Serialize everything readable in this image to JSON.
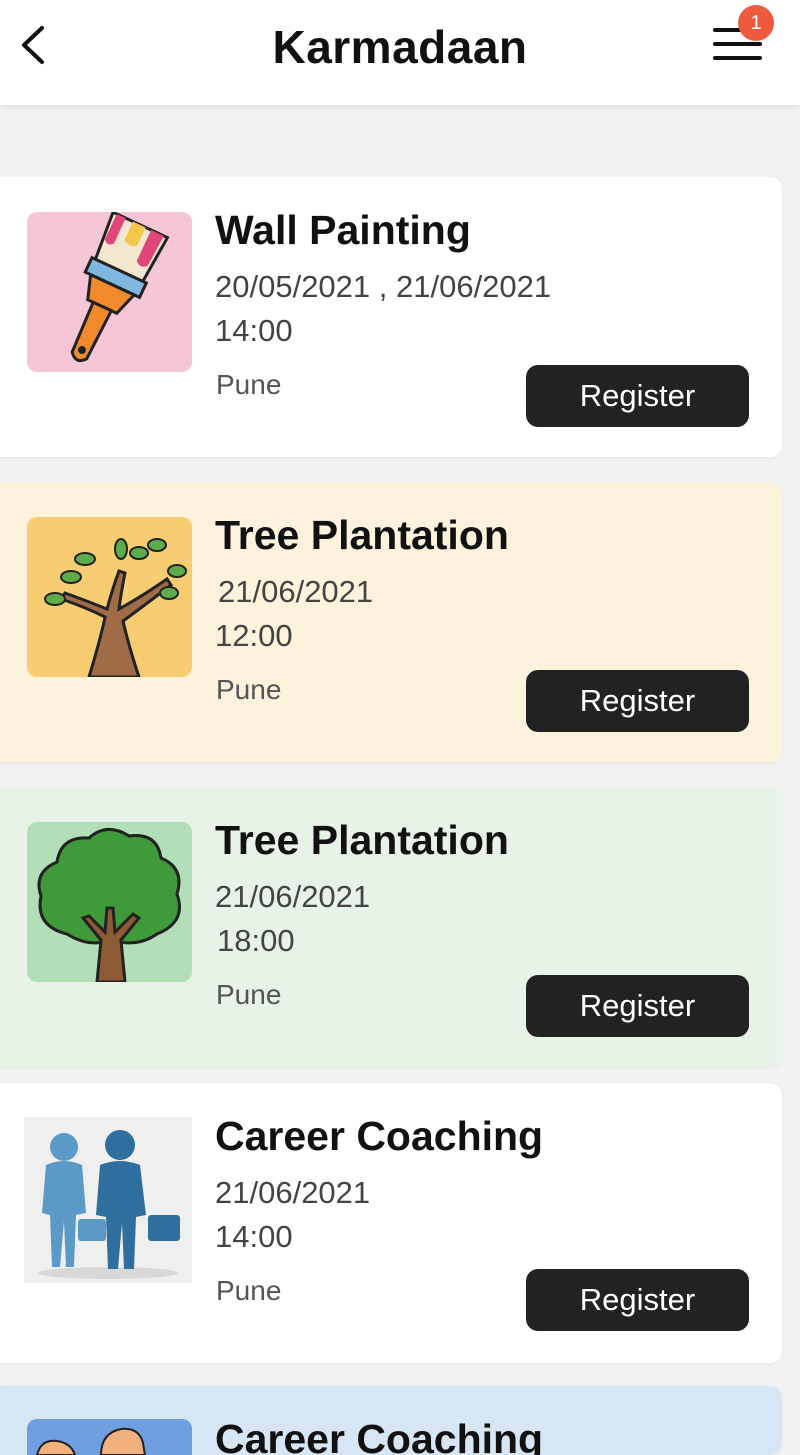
{
  "header": {
    "title": "Karmadaan",
    "back_icon": "chevron-left-icon",
    "menu_icon": "hamburger-menu-icon",
    "notification_count": "1"
  },
  "events": [
    {
      "title": "Wall Painting",
      "date": "20/05/2021 , 21/06/2021",
      "time": "14:00",
      "city": "Pune",
      "register_label": "Register",
      "card_color": "#ffffff",
      "thumb_color": "#f6c6d6",
      "icon": "paintbrush-icon"
    },
    {
      "title": "Tree Plantation",
      "date": "21/06/2021",
      "time": "12:00",
      "city": "Pune",
      "register_label": "Register",
      "card_color": "#fdf3dc",
      "thumb_color": "#f8cd72",
      "icon": "tree-branches-icon"
    },
    {
      "title": "Tree Plantation",
      "date": "21/06/2021",
      "time": "18:00",
      "city": "Pune",
      "register_label": "Register",
      "card_color": "#e6f3e6",
      "thumb_color": "#b3dfb8",
      "icon": "tree-icon"
    },
    {
      "title": "Career Coaching",
      "date": "21/06/2021",
      "time": "14:00",
      "city": "Pune",
      "register_label": "Register",
      "card_color": "#ffffff",
      "thumb_color": "#efefef",
      "icon": "businessmen-handshake-icon"
    },
    {
      "title": "Career Coaching",
      "card_color": "#d6e6f5",
      "thumb_color": "#6f9fe0",
      "icon": "handshake-icon"
    }
  ]
}
